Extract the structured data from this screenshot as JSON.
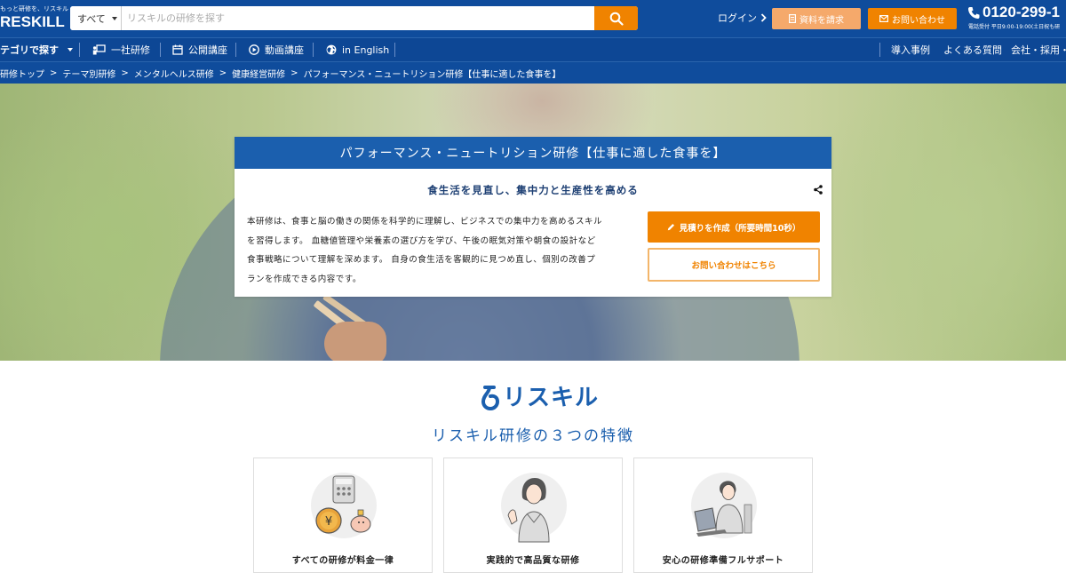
{
  "header": {
    "logo_tagline": "もっと研修を、リスキル",
    "logo_text": "RESKILL",
    "search": {
      "category": "すべて",
      "placeholder": "リスキルの研修を探す",
      "value": ""
    },
    "login_label": "ログイン",
    "request_docs_label": "資料を請求",
    "contact_label": "お問い合わせ",
    "phone": "0120-299-1",
    "phone_note": "電話受付 平日9:00-19:00(土日祝も研"
  },
  "nav": {
    "category_label": "テゴリで探す",
    "items": [
      {
        "label": "一社研修",
        "icon": "presentation-icon"
      },
      {
        "label": "公開講座",
        "icon": "calendar-icon"
      },
      {
        "label": "動画講座",
        "icon": "play-circle-icon"
      },
      {
        "label": "in English",
        "icon": "globe-icon"
      }
    ],
    "right_items": [
      {
        "label": "導入事例"
      },
      {
        "label": "よくある質問"
      },
      {
        "label": "会社・採用・IF"
      }
    ]
  },
  "breadcrumb": [
    "研修トップ",
    "テーマ別研修",
    "メンタルヘルス研修",
    "健康経営研修",
    "パフォーマンス・ニュートリション研修【仕事に適した食事を】"
  ],
  "hero": {
    "title": "パフォーマンス・ニュートリション研修【仕事に適した食事を】",
    "subtitle": "食生活を見直し、集中力と生産性を高める",
    "description": [
      "本研修は、食事と脳の働きの関係を科学的に理解し、ビジネスでの集中力を高めるスキル",
      "を習得します。 血糖値管理や栄養素の選び方を学び、午後の眠気対策や朝食の設計など",
      "食事戦略について理解を深めます。 自身の食生活を客観的に見つめ直し、個別の改善プ",
      "ランを作成できる内容です。"
    ],
    "estimate_button": "見積りを作成（所要時間10秒）",
    "contact_button": "お問い合わせはこちら"
  },
  "features": {
    "brand": "リスキル",
    "title": "リスキル研修の３つの特徴",
    "cards": [
      {
        "label": "すべての研修が料金一律",
        "icon": "calculator-piggybank-icon"
      },
      {
        "label": "実践的で高品質な研修",
        "icon": "trainer-woman-icon"
      },
      {
        "label": "安心の研修準備フルサポート",
        "icon": "support-staff-laptop-icon"
      }
    ]
  },
  "colors": {
    "header_blue": "#0f4c9c",
    "accent_orange": "#f08300",
    "brand_blue": "#1b5fae"
  }
}
